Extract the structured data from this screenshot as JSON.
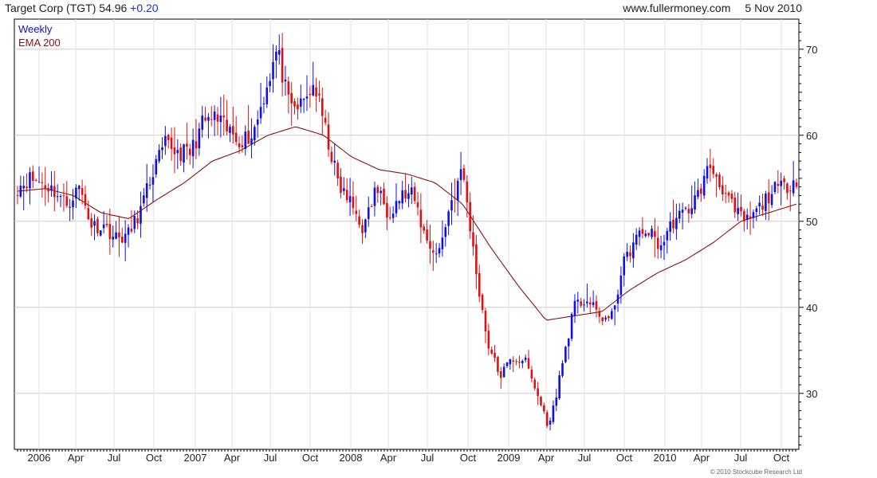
{
  "header": {
    "symbol_title": "Target Corp (TGT) 54.96",
    "change": "+0.20",
    "site": "www.fullermoney.com",
    "date": "5 Nov 2010"
  },
  "copyright": "© 2010 Stockcube Research Ltd",
  "colors": {
    "up": "#1010e0",
    "down": "#e01010",
    "ema": "#8b1010",
    "grid": "#cccccc",
    "axis": "#000000"
  },
  "chart_data": {
    "type": "candlestick",
    "title": "Target Corp (TGT) 54.96 +0.20",
    "legend": [
      {
        "label": "Weekly",
        "color": "#1010c0"
      },
      {
        "label": "EMA 200",
        "color": "#8b1010"
      }
    ],
    "x_tick_labels": [
      "2006",
      "Apr",
      "Jul",
      "Oct",
      "2007",
      "Apr",
      "Jul",
      "Oct",
      "2008",
      "Apr",
      "Jul",
      "Oct",
      "2009",
      "Apr",
      "Jul",
      "Oct",
      "2010",
      "Apr",
      "Jul",
      "Oct"
    ],
    "y_ticks": [
      30,
      40,
      50,
      60,
      70
    ],
    "y_range": [
      23.5,
      73.5
    ],
    "frequency": "weekly",
    "ohlc_anchors": [
      {
        "date": "2005-12",
        "close": 54.0
      },
      {
        "date": "2006-01",
        "close": 55.0
      },
      {
        "date": "2006-02",
        "close": 54.5
      },
      {
        "date": "2006-03",
        "close": 53.5
      },
      {
        "date": "2006-04",
        "close": 52.0
      },
      {
        "date": "2006-05",
        "close": 54.0
      },
      {
        "date": "2006-05b",
        "close": 49.5
      },
      {
        "date": "2006-06",
        "close": 49.5
      },
      {
        "date": "2006-07",
        "close": 48.0
      },
      {
        "date": "2006-08",
        "close": 48.5
      },
      {
        "date": "2006-09",
        "close": 51.5
      },
      {
        "date": "2006-10",
        "close": 56.0
      },
      {
        "date": "2006-11",
        "close": 59.0
      },
      {
        "date": "2006-12",
        "close": 58.0
      },
      {
        "date": "2007-01",
        "close": 58.0
      },
      {
        "date": "2007-02",
        "close": 61.5
      },
      {
        "date": "2007-03",
        "close": 62.0
      },
      {
        "date": "2007-04",
        "close": 60.5
      },
      {
        "date": "2007-05",
        "close": 59.5
      },
      {
        "date": "2007-06",
        "close": 60.0
      },
      {
        "date": "2007-07",
        "close": 65.0
      },
      {
        "date": "2007-07b",
        "close": 70.0
      },
      {
        "date": "2007-08",
        "close": 63.0
      },
      {
        "date": "2007-09",
        "close": 63.5
      },
      {
        "date": "2007-10",
        "close": 66.0
      },
      {
        "date": "2007-11",
        "close": 60.0
      },
      {
        "date": "2007-12",
        "close": 54.0
      },
      {
        "date": "2008-01",
        "close": 52.0
      },
      {
        "date": "2008-02",
        "close": 49.0
      },
      {
        "date": "2008-03",
        "close": 54.0
      },
      {
        "date": "2008-04",
        "close": 51.0
      },
      {
        "date": "2008-05",
        "close": 53.0
      },
      {
        "date": "2008-06",
        "close": 53.0
      },
      {
        "date": "2008-07",
        "close": 48.0
      },
      {
        "date": "2008-08",
        "close": 46.0
      },
      {
        "date": "2008-09",
        "close": 52.0
      },
      {
        "date": "2008-09b",
        "close": 56.0
      },
      {
        "date": "2008-10",
        "close": 45.0
      },
      {
        "date": "2008-10b",
        "close": 36.0
      },
      {
        "date": "2008-11",
        "close": 32.0
      },
      {
        "date": "2008-12",
        "close": 34.0
      },
      {
        "date": "2009-01",
        "close": 34.0
      },
      {
        "date": "2009-02",
        "close": 30.0
      },
      {
        "date": "2009-03",
        "close": 26.0
      },
      {
        "date": "2009-04",
        "close": 33.0
      },
      {
        "date": "2009-05",
        "close": 40.0
      },
      {
        "date": "2009-06",
        "close": 41.0
      },
      {
        "date": "2009-07",
        "close": 39.0
      },
      {
        "date": "2009-08",
        "close": 38.5
      },
      {
        "date": "2009-09",
        "close": 45.0
      },
      {
        "date": "2009-10",
        "close": 48.0
      },
      {
        "date": "2009-11",
        "close": 49.0
      },
      {
        "date": "2009-12",
        "close": 47.0
      },
      {
        "date": "2010-01",
        "close": 50.0
      },
      {
        "date": "2010-02",
        "close": 51.0
      },
      {
        "date": "2010-03",
        "close": 53.0
      },
      {
        "date": "2010-04",
        "close": 56.5
      },
      {
        "date": "2010-05",
        "close": 54.0
      },
      {
        "date": "2010-06",
        "close": 51.0
      },
      {
        "date": "2010-07",
        "close": 50.0
      },
      {
        "date": "2010-08",
        "close": 51.5
      },
      {
        "date": "2010-09",
        "close": 53.5
      },
      {
        "date": "2010-10",
        "close": 54.0
      },
      {
        "date": "2010-11",
        "close": 55.0
      }
    ],
    "ema200_anchors": [
      {
        "date": "2005-12",
        "value": 53.5
      },
      {
        "date": "2006-03",
        "value": 53.8
      },
      {
        "date": "2006-05",
        "value": 53.0
      },
      {
        "date": "2006-08",
        "value": 51.0
      },
      {
        "date": "2006-09",
        "value": 50.3
      },
      {
        "date": "2006-11",
        "value": 52.5
      },
      {
        "date": "2007-01",
        "value": 54.5
      },
      {
        "date": "2007-04",
        "value": 57.0
      },
      {
        "date": "2007-06",
        "value": 58.2
      },
      {
        "date": "2007-08",
        "value": 60.0
      },
      {
        "date": "2007-10",
        "value": 61.0
      },
      {
        "date": "2007-12",
        "value": 60.0
      },
      {
        "date": "2008-02",
        "value": 57.5
      },
      {
        "date": "2008-04",
        "value": 56.0
      },
      {
        "date": "2008-06",
        "value": 55.5
      },
      {
        "date": "2008-08",
        "value": 54.5
      },
      {
        "date": "2008-10",
        "value": 52.0
      },
      {
        "date": "2008-12",
        "value": 47.0
      },
      {
        "date": "2009-02",
        "value": 42.5
      },
      {
        "date": "2009-04",
        "value": 38.5
      },
      {
        "date": "2009-06",
        "value": 39.0
      },
      {
        "date": "2009-08",
        "value": 39.5
      },
      {
        "date": "2009-10",
        "value": 42.0
      },
      {
        "date": "2009-12",
        "value": 44.0
      },
      {
        "date": "2010-02",
        "value": 45.5
      },
      {
        "date": "2010-04",
        "value": 47.5
      },
      {
        "date": "2010-06",
        "value": 50.0
      },
      {
        "date": "2010-08",
        "value": 51.0
      },
      {
        "date": "2010-11",
        "value": 52.0
      }
    ]
  }
}
